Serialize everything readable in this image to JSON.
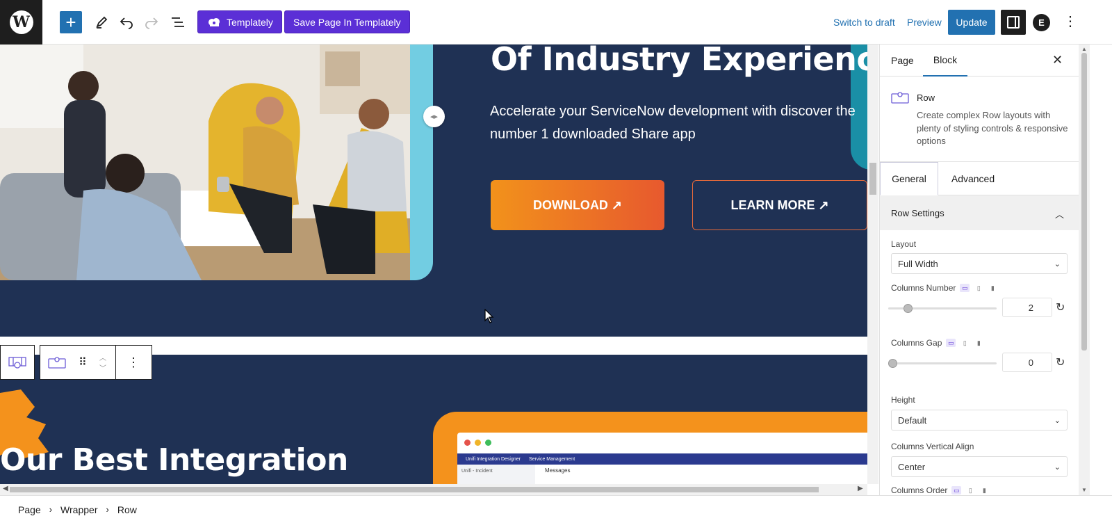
{
  "toolbar": {
    "templately_label": "Templately",
    "save_templately_label": "Save Page In Templately",
    "switch_draft_label": "Switch to draft",
    "preview_label": "Preview",
    "update_label": "Update"
  },
  "hero": {
    "title": "Of Industry Experience",
    "text": "Accelerate your ServiceNow development with discover the number 1 downloaded Share app",
    "download_label": "DOWNLOAD ↗",
    "learn_more_label": "LEARN MORE ↗"
  },
  "section2": {
    "title": "Our Best Integration",
    "app_title": "Unifi Integration Designer",
    "app_menu": "Service Management",
    "app_side": "Unifi - Incident",
    "app_messages": "Messages"
  },
  "breadcrumb": [
    "Page",
    "Wrapper",
    "Row"
  ],
  "sidebar": {
    "tabs": [
      "Page",
      "Block"
    ],
    "active_tab": "Block",
    "block_name": "Row",
    "block_desc": "Create complex Row layouts with plenty of styling controls & responsive options",
    "inner_tabs": [
      "General",
      "Advanced"
    ],
    "active_inner_tab": "General",
    "panel_title": "Row Settings",
    "layout_label": "Layout",
    "layout_value": "Full Width",
    "columns_number_label": "Columns Number",
    "columns_number_value": "2",
    "columns_gap_label": "Columns Gap",
    "columns_gap_value": "0",
    "height_label": "Height",
    "height_value": "Default",
    "vertical_align_label": "Columns Vertical Align",
    "vertical_align_value": "Center",
    "columns_order_label": "Columns Order"
  },
  "colors": {
    "accent": "#2271b1",
    "templately_purple": "#5b2fd6",
    "hero_navy": "#1f3154",
    "orange": "#f4921c",
    "teal": "#72cde2"
  }
}
